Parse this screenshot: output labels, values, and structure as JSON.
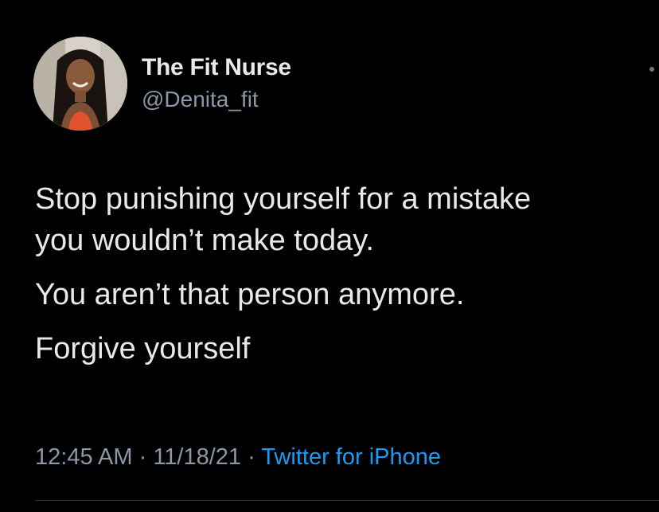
{
  "author": {
    "display_name": "The Fit Nurse",
    "handle": "@Denita_fit",
    "avatar_icon": "profile-photo-avatar"
  },
  "tweet": {
    "paragraphs": [
      "Stop punishing yourself for a mistake",
      "you wouldn’t make today.",
      "You aren’t that person anymore.",
      "Forgive yourself"
    ]
  },
  "meta": {
    "time": "12:45 AM",
    "separator": "·",
    "date": "11/18/21",
    "source": "Twitter for iPhone"
  },
  "colors": {
    "background": "#000000",
    "primary_text": "#e7e9ea",
    "secondary_text": "#8b98a5",
    "link": "#1d9bf0"
  }
}
